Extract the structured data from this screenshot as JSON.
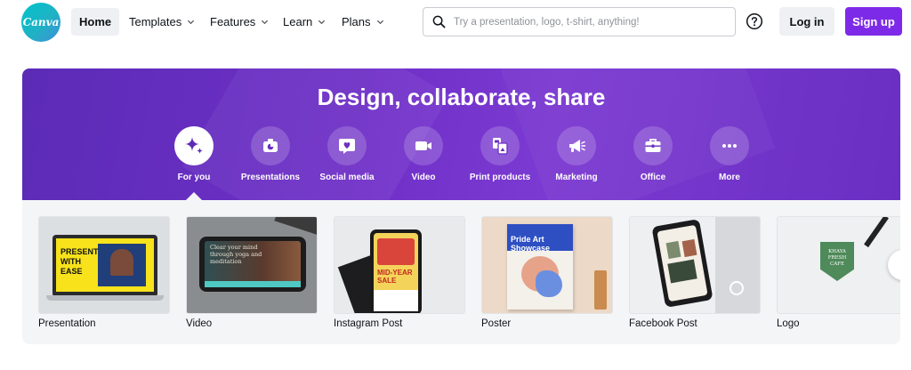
{
  "brand": {
    "logo_text": "Canva",
    "accent": "#7d2ae8",
    "logo_color": "#00c4cc"
  },
  "nav": {
    "items": [
      {
        "label": "Home",
        "dropdown": false
      },
      {
        "label": "Templates",
        "dropdown": true
      },
      {
        "label": "Features",
        "dropdown": true
      },
      {
        "label": "Learn",
        "dropdown": true
      },
      {
        "label": "Plans",
        "dropdown": true
      }
    ],
    "search_placeholder": "Try a presentation, logo, t-shirt, anything!",
    "help_icon": "help-icon",
    "login_label": "Log in",
    "signup_label": "Sign up"
  },
  "hero": {
    "title": "Design, collaborate, share",
    "categories": [
      {
        "label": "For you",
        "icon": "sparkle-icon",
        "active": true
      },
      {
        "label": "Presentations",
        "icon": "presentation-icon",
        "active": false
      },
      {
        "label": "Social media",
        "icon": "heart-chat-icon",
        "active": false
      },
      {
        "label": "Video",
        "icon": "video-camera-icon",
        "active": false
      },
      {
        "label": "Print products",
        "icon": "print-icon",
        "active": false
      },
      {
        "label": "Marketing",
        "icon": "megaphone-icon",
        "active": false
      },
      {
        "label": "Office",
        "icon": "briefcase-icon",
        "active": false
      },
      {
        "label": "More",
        "icon": "more-dots-icon",
        "active": false
      }
    ]
  },
  "templates": {
    "cards": [
      {
        "label": "Presentation",
        "thumb_text": "PRESENT WITH EASE"
      },
      {
        "label": "Video",
        "thumb_text": "Clear your mind through yoga and meditation"
      },
      {
        "label": "Instagram Post",
        "thumb_text": "MID-YEAR SALE"
      },
      {
        "label": "Poster",
        "thumb_text": "Pride Art Showcase"
      },
      {
        "label": "Facebook Post",
        "thumb_text": ""
      },
      {
        "label": "Logo",
        "thumb_text": "KHAYA FRESH CAFE"
      }
    ],
    "next_icon": "chevron-right-icon"
  }
}
